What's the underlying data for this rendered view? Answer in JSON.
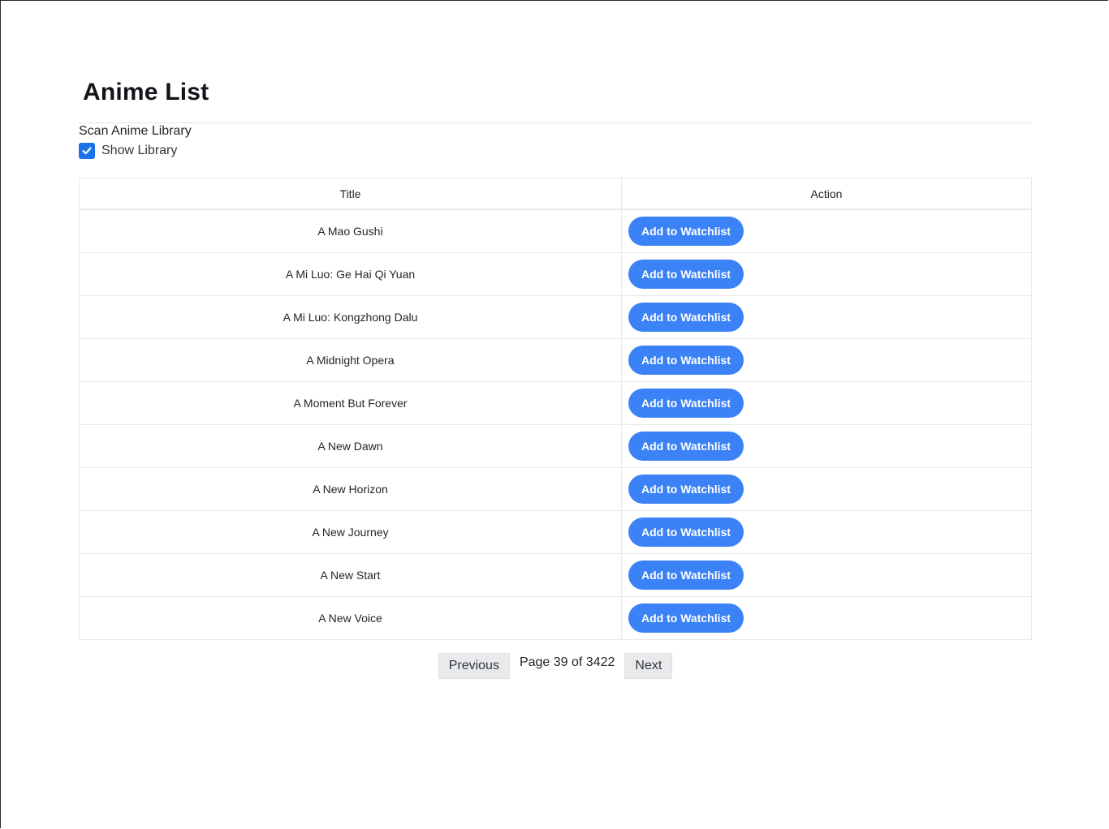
{
  "page": {
    "title": "Anime List",
    "scan_label": "Scan Anime Library",
    "show_library_label": "Show Library",
    "show_library_checked": true
  },
  "table": {
    "headers": {
      "title": "Title",
      "action": "Action"
    },
    "rows": [
      {
        "title": "A Mao Gushi",
        "action_label": "Add to Watchlist"
      },
      {
        "title": "A Mi Luo: Ge Hai Qi Yuan",
        "action_label": "Add to Watchlist"
      },
      {
        "title": "A Mi Luo: Kongzhong Dalu",
        "action_label": "Add to Watchlist"
      },
      {
        "title": "A Midnight Opera",
        "action_label": "Add to Watchlist"
      },
      {
        "title": "A Moment But Forever",
        "action_label": "Add to Watchlist"
      },
      {
        "title": "A New Dawn",
        "action_label": "Add to Watchlist"
      },
      {
        "title": "A New Horizon",
        "action_label": "Add to Watchlist"
      },
      {
        "title": "A New Journey",
        "action_label": "Add to Watchlist"
      },
      {
        "title": "A New Start",
        "action_label": "Add to Watchlist"
      },
      {
        "title": "A New Voice",
        "action_label": "Add to Watchlist"
      }
    ]
  },
  "pagination": {
    "previous_label": "Previous",
    "page_text": "Page 39 of 3422",
    "next_label": "Next"
  },
  "colors": {
    "accent": "#3b82f6",
    "checkbox": "#1a73e8"
  }
}
